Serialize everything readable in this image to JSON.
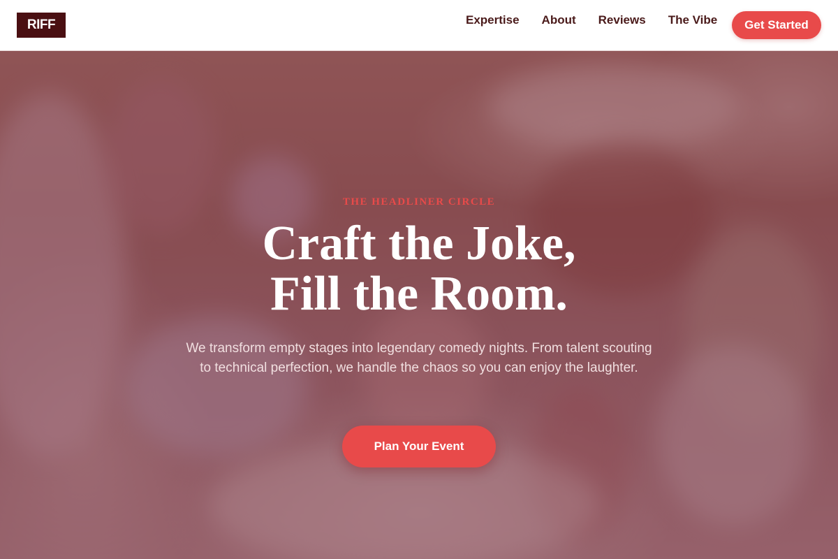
{
  "brand": {
    "logo_text": "RIFF",
    "accent_color": "#e84a4a",
    "logo_bg_color": "#4a0f12"
  },
  "nav": {
    "links": [
      {
        "label": "Expertise"
      },
      {
        "label": "About"
      },
      {
        "label": "Reviews"
      },
      {
        "label": "The Vibe"
      }
    ],
    "cta_label": "Get Started"
  },
  "hero": {
    "eyebrow": "THE HEADLINER CIRCLE",
    "headline_line1": "Craft the Joke,",
    "headline_line2": "Fill the Room.",
    "subtext": "We transform empty stages into legendary comedy nights. From talent scouting to technical perfection, we handle the chaos so you can enjoy the laughter.",
    "cta_label": "Plan Your Event",
    "background_image": "blurred banquet table with flowers and place settings"
  }
}
